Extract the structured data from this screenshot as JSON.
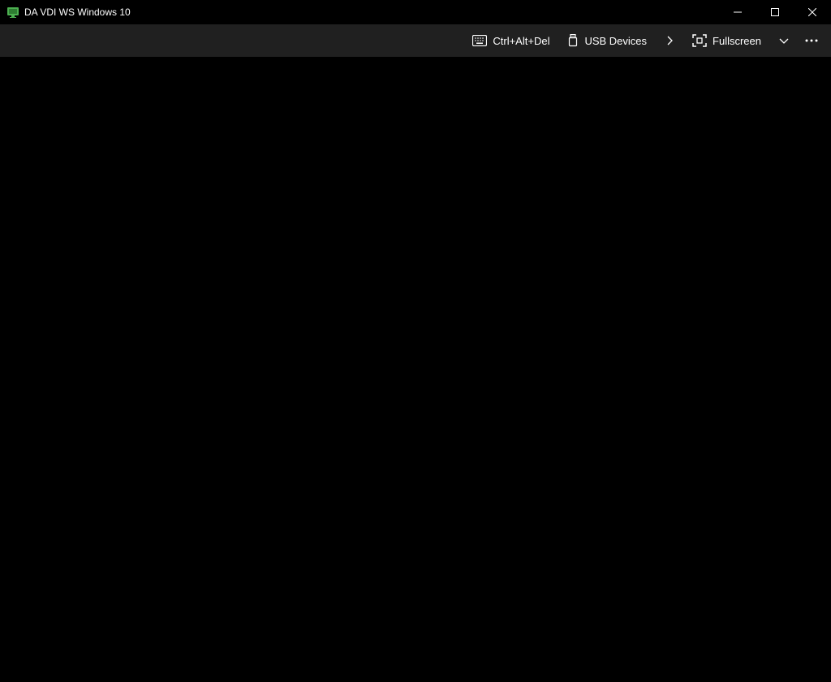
{
  "window": {
    "title": "DA VDI WS Windows 10"
  },
  "toolbar": {
    "ctrl_alt_del_label": "Ctrl+Alt+Del",
    "usb_devices_label": "USB Devices",
    "fullscreen_label": "Fullscreen"
  }
}
